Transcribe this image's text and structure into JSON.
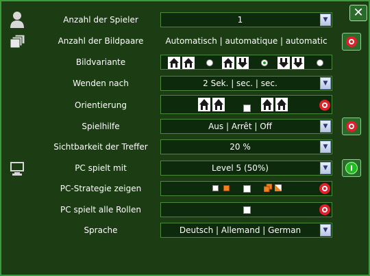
{
  "icons": {
    "player": "person-icon",
    "pairs": "overlapping-cards-icon",
    "pc": "monitor-icon",
    "close": "close-icon",
    "dropdown": "chevron-down-icon",
    "toggle_off": "red-toggle-icon",
    "toggle_on": "green-toggle-icon"
  },
  "colors": {
    "background": "#1c3c14",
    "border": "#3c9c3c",
    "toggle_off": "#e0202a",
    "toggle_on": "#22bb22",
    "accent_orange": "#f08020"
  },
  "close": {
    "label": "✕"
  },
  "rows": {
    "players": {
      "label": "Anzahl der Spieler",
      "value": "1"
    },
    "pairs": {
      "label": "Anzahl der Bildpaare",
      "value": "Automatisch | automatique | automatic",
      "toggle": "off"
    },
    "variant": {
      "label": "Bildvariante",
      "selected_option": 2
    },
    "turn": {
      "label": "Wenden nach",
      "value": "2 Sek. | sec. | sec."
    },
    "orientation": {
      "label": "Orientierung",
      "toggle": "off"
    },
    "hint": {
      "label": "Spielhilfe",
      "value": "Aus | Arrêt | Off",
      "toggle": "off"
    },
    "visibility": {
      "label": "Sichtbarkeit der Treffer",
      "value": "20 %"
    },
    "pcplays": {
      "label": "PC spielt mit",
      "value": "Level 5 (50%)",
      "toggle": "on"
    },
    "strategy": {
      "label": "PC-Strategie zeigen",
      "toggle": "off"
    },
    "allroles": {
      "label": "PC spielt alle Rollen",
      "toggle": "off"
    },
    "language": {
      "label": "Sprache",
      "value": "Deutsch | Allemand | German"
    }
  }
}
